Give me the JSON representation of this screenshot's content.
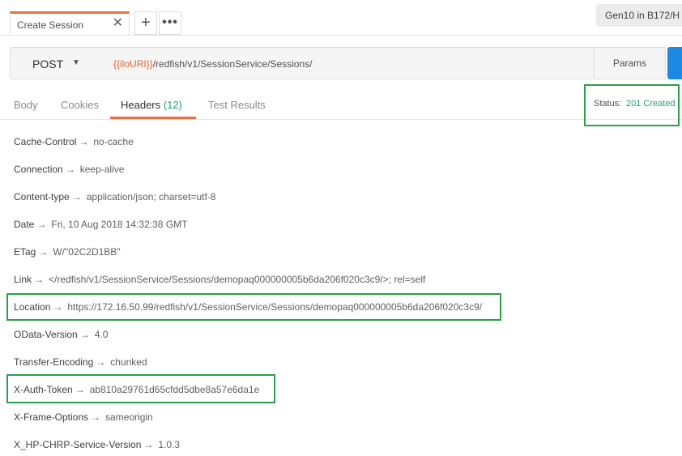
{
  "tabbar": {
    "active_tab_label": "Create Session",
    "close_glyph": "✕",
    "add_glyph": "+",
    "more_glyph": "•••",
    "environment": "Gen10 in B172/H"
  },
  "request": {
    "method": "POST",
    "url_variable": "{{iloURI}}",
    "url_path": "/redfish/v1/SessionService/Sessions/",
    "params_label": "Params"
  },
  "response_tabs": {
    "body": "Body",
    "cookies": "Cookies",
    "headers": "Headers",
    "headers_count": "(12)",
    "test_results": "Test Results"
  },
  "status": {
    "label": "Status:",
    "value": "201 Created"
  },
  "headers": [
    {
      "key": "Cache-Control",
      "value": "no-cache"
    },
    {
      "key": "Connection",
      "value": "keep-alive"
    },
    {
      "key": "Content-type",
      "value": "application/json; charset=utf-8"
    },
    {
      "key": "Date",
      "value": "Fri, 10 Aug 2018 14:32:38 GMT"
    },
    {
      "key": "ETag",
      "value": "W/\"02C2D1BB\""
    },
    {
      "key": "Link",
      "value": "</redfish/v1/SessionService/Sessions/demopaq000000005b6da206f020c3c9/>; rel=self"
    },
    {
      "key": "Location",
      "value": "https://172.16.50.99/redfish/v1/SessionService/Sessions/demopaq000000005b6da206f020c3c9/"
    },
    {
      "key": "OData-Version",
      "value": "4.0"
    },
    {
      "key": "Transfer-Encoding",
      "value": "chunked"
    },
    {
      "key": "X-Auth-Token",
      "value": "ab810a29761d65cfdd5dbe8a57e6da1e"
    },
    {
      "key": "X-Frame-Options",
      "value": "sameorigin"
    },
    {
      "key": "X_HP-CHRP-Service-Version",
      "value": "1.0.3"
    }
  ],
  "arrow_glyph": "→",
  "colors": {
    "accent_orange": "#f26b3a",
    "status_green": "#22a36b",
    "highlight_green": "#2aa04a",
    "send_blue": "#1e88e5"
  }
}
